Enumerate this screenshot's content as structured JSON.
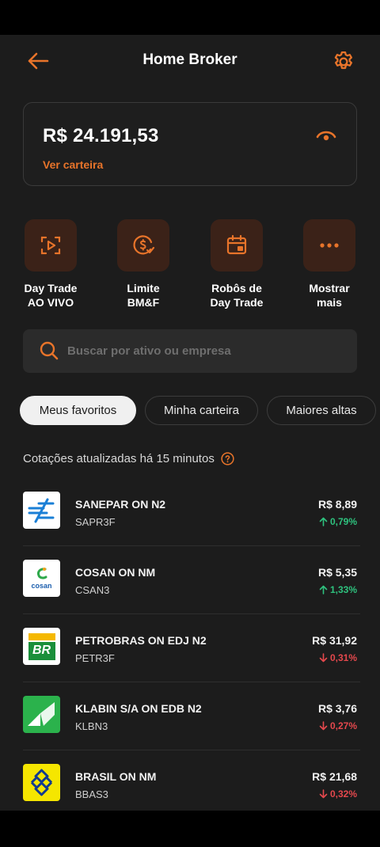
{
  "header": {
    "title": "Home Broker",
    "back_icon": "arrow-left-icon",
    "settings_icon": "gear-icon"
  },
  "balance": {
    "amount": "R$ 24.191,53",
    "link": "Ver carteira",
    "eye_icon": "eye-icon"
  },
  "actions": [
    {
      "line1": "Day Trade",
      "line2": "AO VIVO",
      "icon": "play-frame-icon"
    },
    {
      "line1": "Limite",
      "line2": "BM&F",
      "icon": "dollar-check-icon"
    },
    {
      "line1": "Robôs de",
      "line2": "Day Trade",
      "icon": "calendar-robot-icon"
    },
    {
      "line1": "Mostrar",
      "line2": "mais",
      "icon": "more-dots-icon"
    }
  ],
  "search": {
    "placeholder": "Buscar por ativo ou empresa"
  },
  "tabs": [
    "Meus favoritos",
    "Minha carteira",
    "Maiores altas"
  ],
  "notice": "Cotações atualizadas há 15 minutos",
  "stocks": [
    {
      "name": "SANEPAR ON N2",
      "ticker": "SAPR3F",
      "price": "R$ 8,89",
      "change": "0,79%",
      "direction": "up"
    },
    {
      "name": "COSAN ON NM",
      "ticker": "CSAN3",
      "price": "R$ 5,35",
      "change": "1,33%",
      "direction": "up"
    },
    {
      "name": "PETROBRAS ON EDJ N2",
      "ticker": "PETR3F",
      "price": "R$ 31,92",
      "change": "0,31%",
      "direction": "down"
    },
    {
      "name": "KLABIN S/A ON EDB N2",
      "ticker": "KLBN3",
      "price": "R$ 3,76",
      "change": "0,27%",
      "direction": "down"
    },
    {
      "name": "BRASIL ON NM",
      "ticker": "BBAS3",
      "price": "R$ 21,68",
      "change": "0,32%",
      "direction": "down"
    }
  ],
  "logos": {
    "sanepar": "sanepar-logo",
    "cosan_text": "cosan",
    "petrobras_text": "BR",
    "klabin": "klabin-logo",
    "brasil": "banco-do-brasil-logo"
  },
  "colors": {
    "accent": "#e8742a",
    "up": "#2ec27e",
    "down": "#e5484d",
    "background": "#1c1c1c"
  }
}
